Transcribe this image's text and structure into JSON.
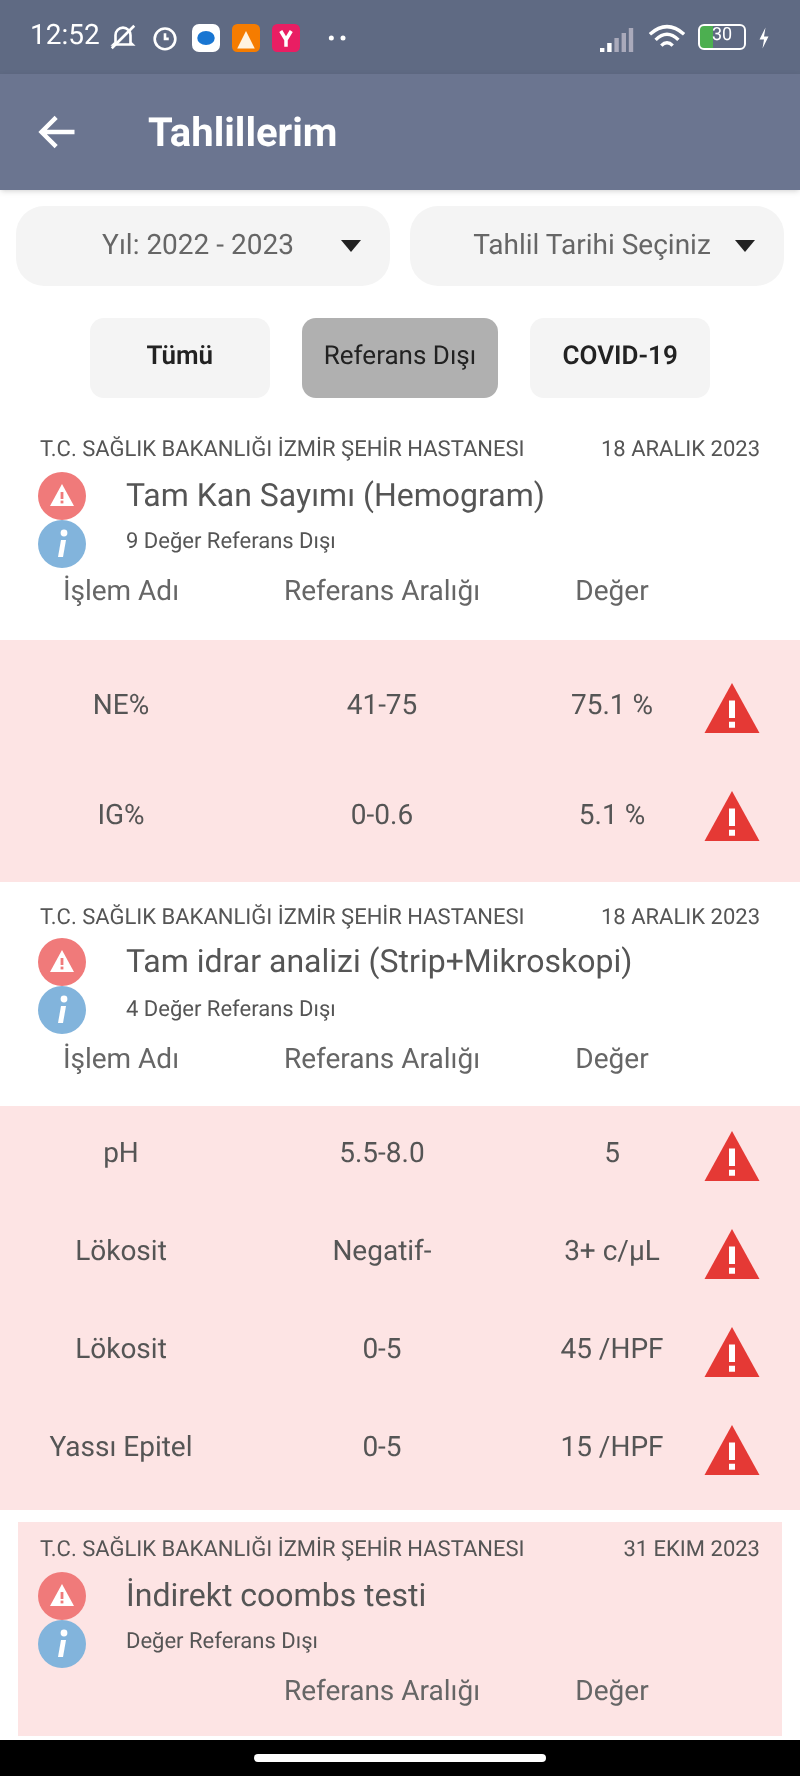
{
  "status_bar": {
    "time": "12:52",
    "battery": "30"
  },
  "app_bar": {
    "title": "Tahlillerim"
  },
  "filters": [
    {
      "value": "Yıl: 2022 - 2023"
    },
    {
      "value": "Tahlil Tarihi Seçiniz"
    }
  ],
  "tabs": [
    {
      "label": "Tümü",
      "selected": false
    },
    {
      "label": "Referans Dışı",
      "selected": true
    },
    {
      "label": "COVID-19",
      "selected": false
    }
  ],
  "cards": [
    {
      "hospital": "T.C. SAĞLIK BAKANLIĞI İZMİR ŞEHİR HASTANESI",
      "date": "18 ARALIK 2023",
      "title": "Tam Kan Sayımı (Hemogram)",
      "summary": "9 Değer Referans Dışı",
      "highlighted": false,
      "columns": [
        "İşlem Adı",
        "Referans Aralığı",
        "Değer"
      ],
      "rows": [
        {
          "name": "NE%",
          "range": "41-75",
          "value": "75.1 %",
          "out_of_range": true
        },
        {
          "name": "IG%",
          "range": "0-0.6",
          "value": "5.1 %",
          "out_of_range": true
        }
      ]
    },
    {
      "hospital": "T.C. SAĞLIK BAKANLIĞI İZMİR ŞEHİR HASTANESI",
      "date": "18 ARALIK 2023",
      "title": "Tam idrar analizi (Strip+Mikroskopi)",
      "summary": "4 Değer Referans Dışı",
      "highlighted": false,
      "columns": [
        "İşlem Adı",
        "Referans Aralığı",
        "Değer"
      ],
      "rows": [
        {
          "name": "pH",
          "range": "5.5-8.0",
          "value": "5",
          "out_of_range": true
        },
        {
          "name": "Lökosit",
          "range": "Negatif-",
          "value": "3+ c/µL",
          "out_of_range": true
        },
        {
          "name": "Lökosit",
          "range": "0-5",
          "value": "45 /HPF",
          "out_of_range": true
        },
        {
          "name": "Yassı Epitel",
          "range": "0-5",
          "value": "15 /HPF",
          "out_of_range": true
        }
      ]
    },
    {
      "hospital": "T.C. SAĞLIK BAKANLIĞI İZMİR ŞEHİR HASTANESI",
      "date": "31 EKIM 2023",
      "title": "İndirekt coombs testi",
      "summary": "Değer Referans Dışı",
      "highlighted": true,
      "columns": [
        "",
        "Referans Aralığı",
        "Değer"
      ]
    }
  ]
}
